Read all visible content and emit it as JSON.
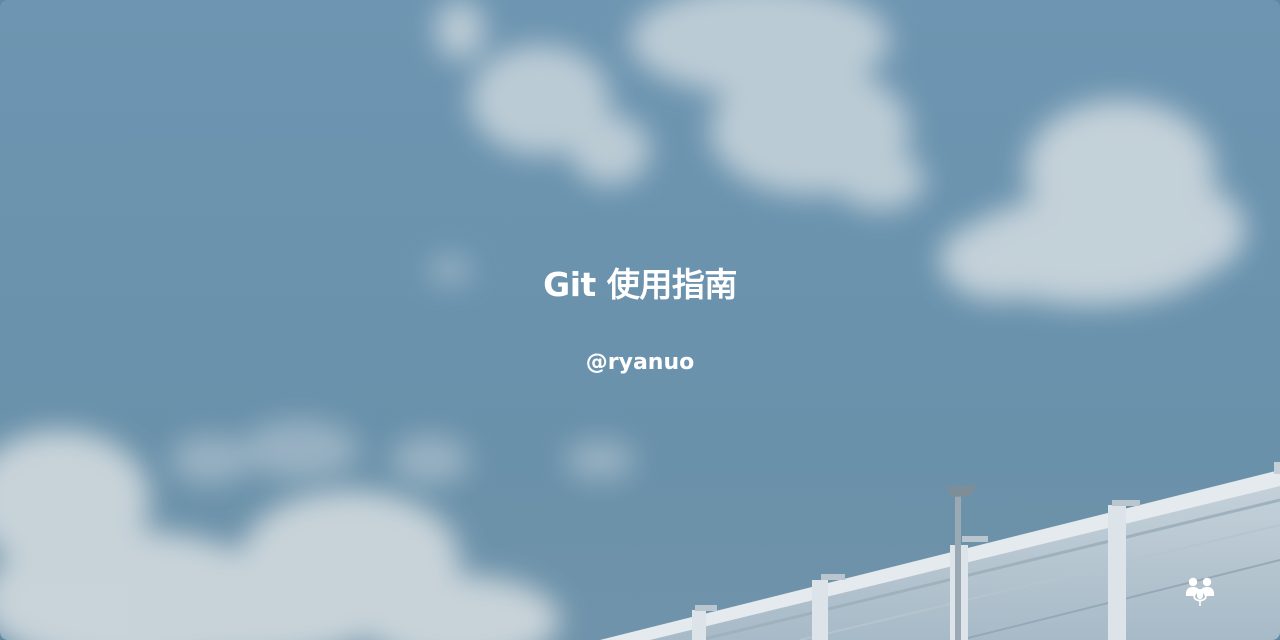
{
  "slide": {
    "title": "Git 使用指南",
    "author": "@ryanuo",
    "logo_icon": "community-speaker-icon",
    "background": "sky-clouds-building-photo"
  },
  "colors": {
    "text": "#ffffff",
    "sky": "#6b93ae"
  }
}
